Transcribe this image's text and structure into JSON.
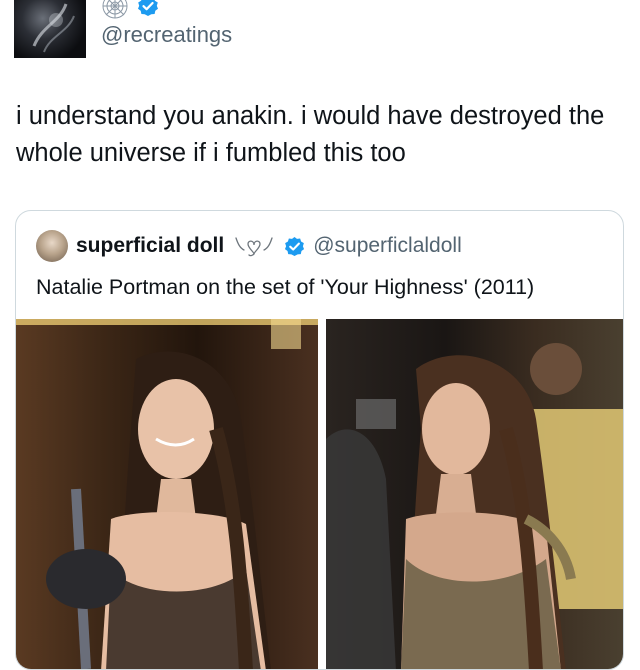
{
  "author": {
    "handle": "@recreatings",
    "avatar_icon": "dark-portrait-avatar",
    "badge_icon": "cobweb-icon",
    "verified_icon": "verified-badge-icon"
  },
  "tweet": {
    "text": "i understand you anakin. i would have destroyed the whole universe if i fumbled this too"
  },
  "quoted": {
    "name": "superficial doll",
    "name_decoration": "ribbon-heart-emoji",
    "handle": "@superficlaldoll",
    "verified_icon": "verified-badge-icon",
    "text": "Natalie Portman on the set of 'Your Highness' (2011)",
    "photos": [
      {
        "icon": "photo-natalie-portman-smiling"
      },
      {
        "icon": "photo-natalie-portman-profile"
      }
    ]
  },
  "colors": {
    "text": "#0f1419",
    "secondary": "#536471",
    "verified": "#1d9bf0",
    "border": "#cfd9de"
  }
}
